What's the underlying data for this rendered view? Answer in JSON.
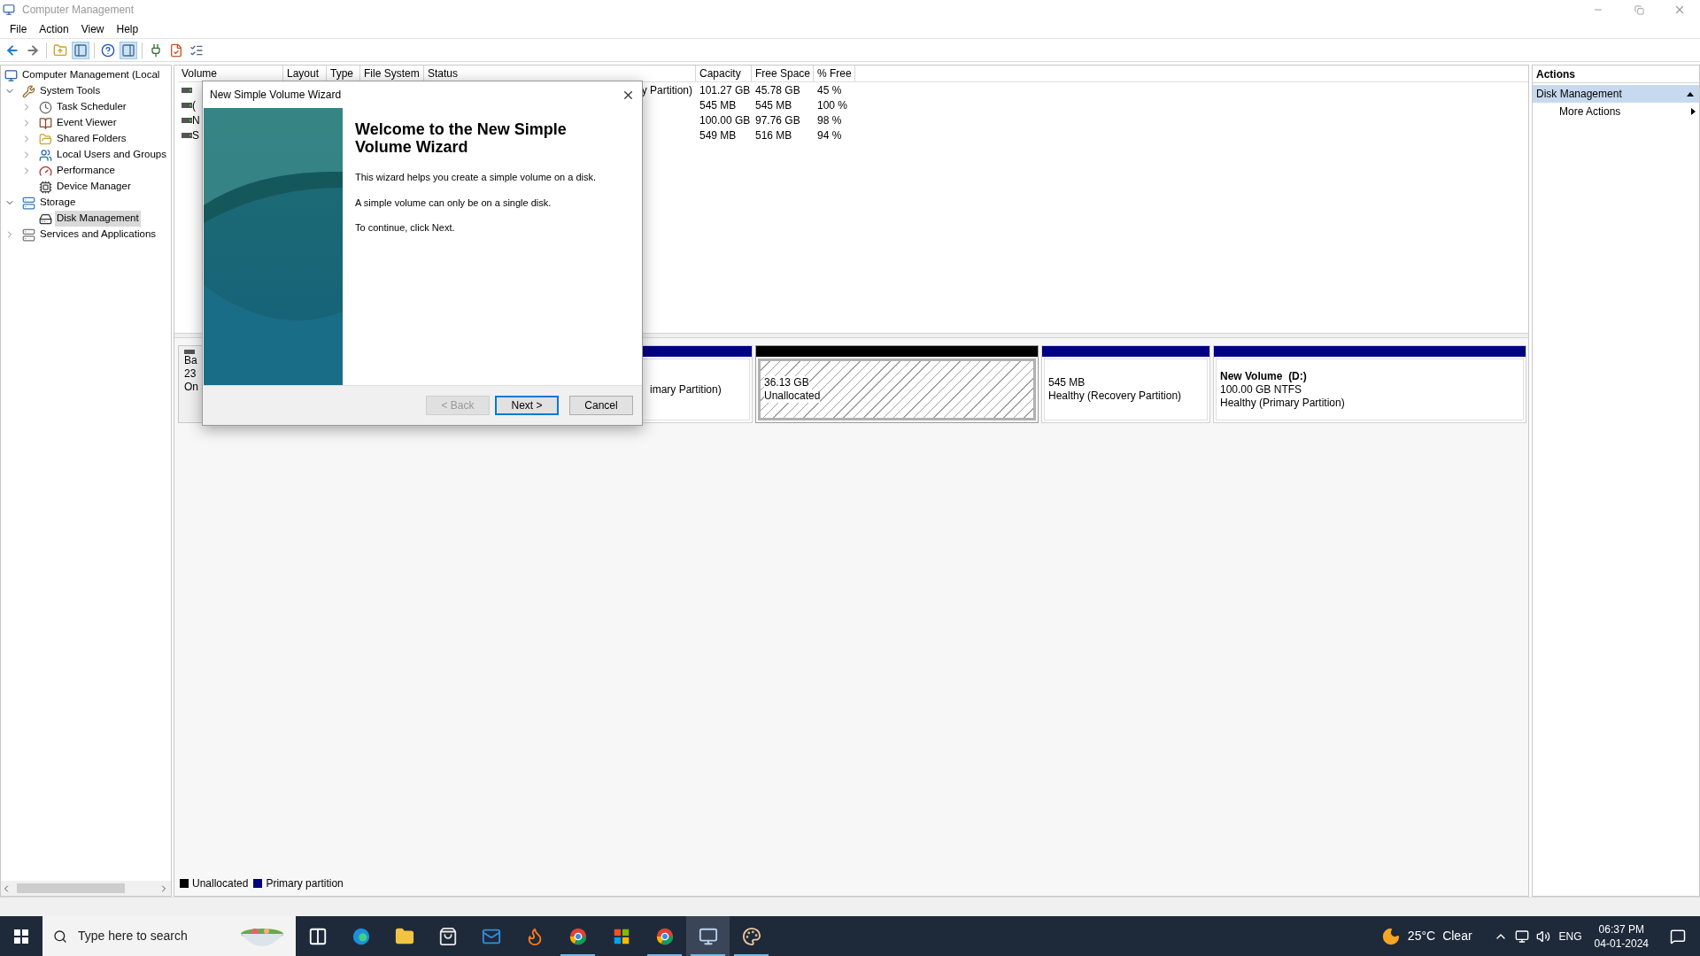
{
  "window": {
    "title": "Computer Management"
  },
  "menu": [
    "File",
    "Action",
    "View",
    "Help"
  ],
  "toolbar": [
    {
      "kind": "back",
      "pressed": false
    },
    {
      "kind": "forward",
      "pressed": false
    },
    {
      "kind": "sep"
    },
    {
      "kind": "up",
      "pressed": false
    },
    {
      "kind": "tree",
      "pressed": true
    },
    {
      "kind": "sep"
    },
    {
      "kind": "help",
      "pressed": false
    },
    {
      "kind": "pane",
      "pressed": true
    },
    {
      "kind": "sep"
    },
    {
      "kind": "connect",
      "pressed": false
    },
    {
      "kind": "check",
      "pressed": false
    },
    {
      "kind": "list",
      "pressed": false
    }
  ],
  "tree": [
    {
      "label": "Computer Management (Local",
      "kind": "computer",
      "selected": false,
      "children": [
        {
          "label": "System Tools",
          "kind": "tools",
          "expanded": true,
          "selected": false,
          "children": [
            {
              "label": "Task Scheduler",
              "kind": "clock",
              "expanded": false,
              "selected": false
            },
            {
              "label": "Event Viewer",
              "kind": "log",
              "expanded": false,
              "selected": false
            },
            {
              "label": "Shared Folders",
              "kind": "folder",
              "expanded": false,
              "selected": false
            },
            {
              "label": "Local Users and Groups",
              "kind": "users",
              "expanded": false,
              "selected": false
            },
            {
              "label": "Performance",
              "kind": "gauge",
              "expanded": false,
              "selected": false
            },
            {
              "label": "Device Manager",
              "kind": "device",
              "selected": false
            }
          ]
        },
        {
          "label": "Storage",
          "kind": "storage",
          "expanded": true,
          "selected": false,
          "children": [
            {
              "label": "Disk Management",
              "kind": "disk",
              "selected": true
            }
          ]
        },
        {
          "label": "Services and Applications",
          "kind": "services",
          "expanded": false,
          "selected": false
        }
      ]
    }
  ],
  "table": {
    "columns": [
      "Volume",
      "Layout",
      "Type",
      "File System",
      "Status",
      "Capacity",
      "Free Space",
      "% Free"
    ],
    "rows": [
      {
        "status": "y Partition)",
        "capacity": "101.27 GB",
        "free_space": "45.78 GB",
        "percent_free": "45 %"
      },
      {
        "volume": "(",
        "capacity": "545 MB",
        "free_space": "545 MB",
        "percent_free": "100 %"
      },
      {
        "volume": "N",
        "capacity": "100.00 GB",
        "free_space": "97.76 GB",
        "percent_free": "98 %"
      },
      {
        "volume": "S",
        "capacity": "549 MB",
        "free_space": "516 MB",
        "percent_free": "94 %"
      }
    ]
  },
  "disk": {
    "label_lines": [
      "Ba",
      "23",
      "On"
    ],
    "partitions": [
      {
        "kind": "primary",
        "color": "#000080",
        "selected": false,
        "lines": [
          "imary Partition)"
        ]
      },
      {
        "kind": "unallocated",
        "color": "#000000",
        "selected": true,
        "lines": [
          "36.13 GB",
          "Unallocated"
        ]
      },
      {
        "kind": "primary",
        "color": "#000080",
        "selected": false,
        "lines": [
          "545 MB",
          "Healthy (Recovery Partition)"
        ]
      },
      {
        "kind": "primary",
        "color": "#000080",
        "selected": false,
        "name": "New Volume  (D:)",
        "lines": [
          "100.00 GB NTFS",
          "Healthy (Primary Partition)"
        ]
      }
    ]
  },
  "legend": [
    {
      "label": "Unallocated",
      "color": "#000000"
    },
    {
      "label": "Primary partition",
      "color": "#000080"
    }
  ],
  "dialog": {
    "title": "New Simple Volume Wizard",
    "heading": "Welcome to the New Simple Volume Wizard",
    "paragraphs": [
      "This wizard helps you create a simple volume on a disk.",
      "A simple volume can only be on a single disk.",
      "To continue, click Next."
    ],
    "buttons": [
      {
        "label": "< Back",
        "disabled": true,
        "default": false
      },
      {
        "label": "Next >",
        "disabled": false,
        "default": true
      },
      {
        "label": "Cancel",
        "disabled": false,
        "default": false
      }
    ]
  },
  "actions": {
    "title": "Actions",
    "items": [
      {
        "label": "Disk Management",
        "kind": "header"
      },
      {
        "label": "More Actions",
        "kind": "submenu"
      }
    ]
  },
  "taskbar": {
    "search_placeholder": "Type here to search",
    "apps": [
      {
        "kind": "taskview",
        "running": false,
        "selected": false
      },
      {
        "kind": "edge",
        "running": false,
        "selected": false
      },
      {
        "kind": "explorer",
        "running": false,
        "selected": false
      },
      {
        "kind": "store",
        "running": false,
        "selected": false
      },
      {
        "kind": "mail",
        "running": false,
        "selected": false
      },
      {
        "kind": "firefox",
        "running": false,
        "selected": false
      },
      {
        "kind": "chrome",
        "running": true,
        "selected": false
      },
      {
        "kind": "office",
        "running": false,
        "selected": false
      },
      {
        "kind": "chrome",
        "running": true,
        "selected": false
      },
      {
        "kind": "compmgmt",
        "running": true,
        "selected": true
      },
      {
        "kind": "paint",
        "running": true,
        "selected": false
      }
    ],
    "temperature": "25°C",
    "weather": "Clear",
    "language": "ENG",
    "time": "06:37 PM",
    "date": "04-01-2024"
  }
}
